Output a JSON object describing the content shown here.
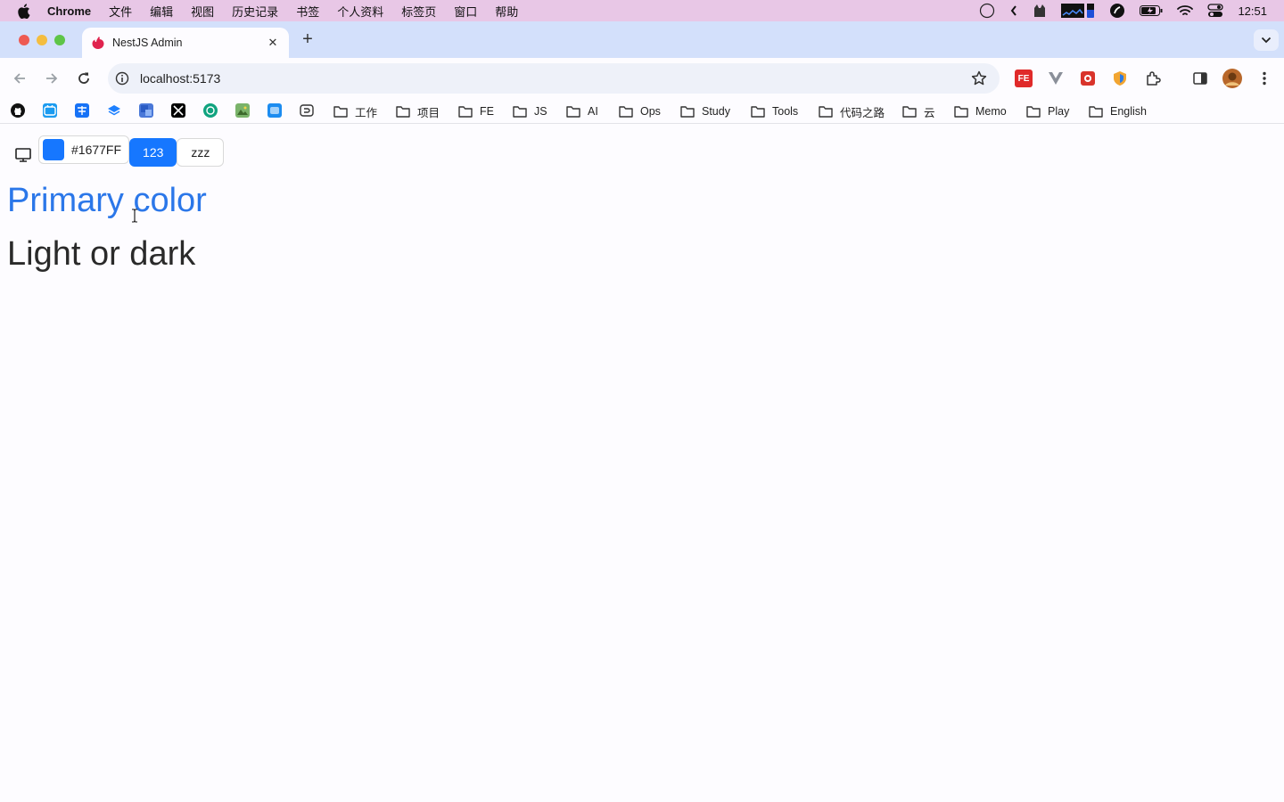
{
  "menubar": {
    "app_name": "Chrome",
    "items": [
      "文件",
      "编辑",
      "视图",
      "历史记录",
      "书签",
      "个人资料",
      "标签页",
      "窗口",
      "帮助"
    ],
    "clock": "12:51"
  },
  "tab": {
    "title": "NestJS Admin",
    "close_glyph": "✕",
    "new_tab_glyph": "+"
  },
  "omnibox": {
    "url": "localhost:5173"
  },
  "extensions": [
    {
      "name": "fe-helper-extension",
      "label": "FE",
      "color": "#e02a2a"
    },
    {
      "name": "vue-devtools-extension",
      "label": "V",
      "color": "#8a8f99"
    },
    {
      "name": "screenshot-extension",
      "label": "",
      "color": "#d9342b"
    },
    {
      "name": "shield-extension",
      "label": "",
      "color": "#f2a531"
    },
    {
      "name": "extensions-puzzle",
      "label": "",
      "color": "#333333"
    }
  ],
  "bookmarks": {
    "folders": [
      "工作",
      "项目",
      "FE",
      "JS",
      "AI",
      "Ops",
      "Study",
      "Tools",
      "代码之路",
      "云",
      "Memo",
      "Play",
      "English"
    ]
  },
  "page": {
    "color_value": "#1677FF",
    "primary_button_label": "123",
    "default_button_label": "zzz",
    "heading_primary": "Primary color",
    "heading_mode": "Light or dark"
  },
  "colors": {
    "primary": "#1677ff",
    "heading_primary": "#2b77e9"
  }
}
